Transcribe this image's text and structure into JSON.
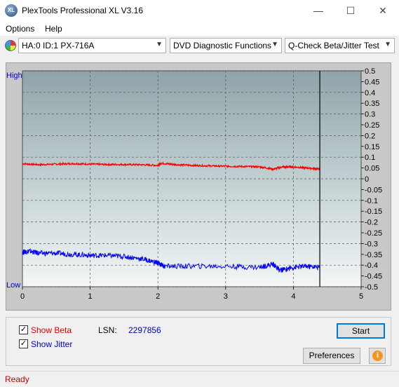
{
  "window": {
    "title": "PlexTools Professional XL V3.16",
    "icon_text": "XL"
  },
  "controls": {
    "minimize": "—",
    "maximize": "☐",
    "close": "✕"
  },
  "menu": {
    "options": "Options",
    "help": "Help"
  },
  "toolbar": {
    "drive": "HA:0 ID:1  PX-716A",
    "function": "DVD Diagnostic Functions",
    "test": "Q-Check Beta/Jitter Test",
    "arrow": "▼"
  },
  "chart_data": {
    "type": "line",
    "y_left_high": "High",
    "y_left_low": "Low",
    "x_ticks": [
      "0",
      "1",
      "2",
      "3",
      "4",
      "5"
    ],
    "y_ticks": [
      "0.5",
      "0.45",
      "0.4",
      "0.35",
      "0.3",
      "0.25",
      "0.2",
      "0.15",
      "0.1",
      "0.05",
      "0",
      "-0.05",
      "-0.1",
      "-0.15",
      "-0.2",
      "-0.25",
      "-0.3",
      "-0.35",
      "-0.4",
      "-0.45",
      "-0.5"
    ],
    "xlim": [
      0,
      5
    ],
    "ylim": [
      -0.5,
      0.5
    ],
    "grid": true,
    "end_marker_x": 4.39,
    "series": [
      {
        "color": "#ff0000",
        "x": [
          0,
          0.25,
          0.5,
          0.75,
          1.0,
          1.25,
          1.5,
          1.75,
          2.0,
          2.05,
          2.25,
          2.5,
          2.75,
          3.0,
          3.25,
          3.5,
          3.7,
          3.85,
          4.0,
          4.2,
          4.39
        ],
        "y": [
          0.07,
          0.065,
          0.068,
          0.07,
          0.068,
          0.066,
          0.066,
          0.065,
          0.062,
          0.072,
          0.066,
          0.062,
          0.06,
          0.058,
          0.057,
          0.055,
          0.045,
          0.055,
          0.055,
          0.05,
          0.045
        ]
      },
      {
        "color": "#0000ff",
        "x": [
          0,
          0.1,
          0.25,
          0.5,
          0.75,
          1.0,
          1.25,
          1.5,
          1.75,
          1.95,
          2.0,
          2.1,
          2.5,
          3.0,
          3.5,
          3.7,
          3.8,
          4.0,
          4.2,
          4.39
        ],
        "y": [
          -0.34,
          -0.335,
          -0.345,
          -0.345,
          -0.35,
          -0.355,
          -0.355,
          -0.36,
          -0.37,
          -0.385,
          -0.39,
          -0.405,
          -0.405,
          -0.405,
          -0.41,
          -0.395,
          -0.425,
          -0.41,
          -0.405,
          -0.41
        ]
      }
    ]
  },
  "bottom": {
    "show_beta": "Show Beta",
    "show_jitter": "Show Jitter",
    "lsn_label": "LSN:",
    "lsn_value": "2297856",
    "start": "Start",
    "preferences": "Preferences",
    "info_icon": "i",
    "check": "✓"
  },
  "status": {
    "text": "Ready"
  }
}
